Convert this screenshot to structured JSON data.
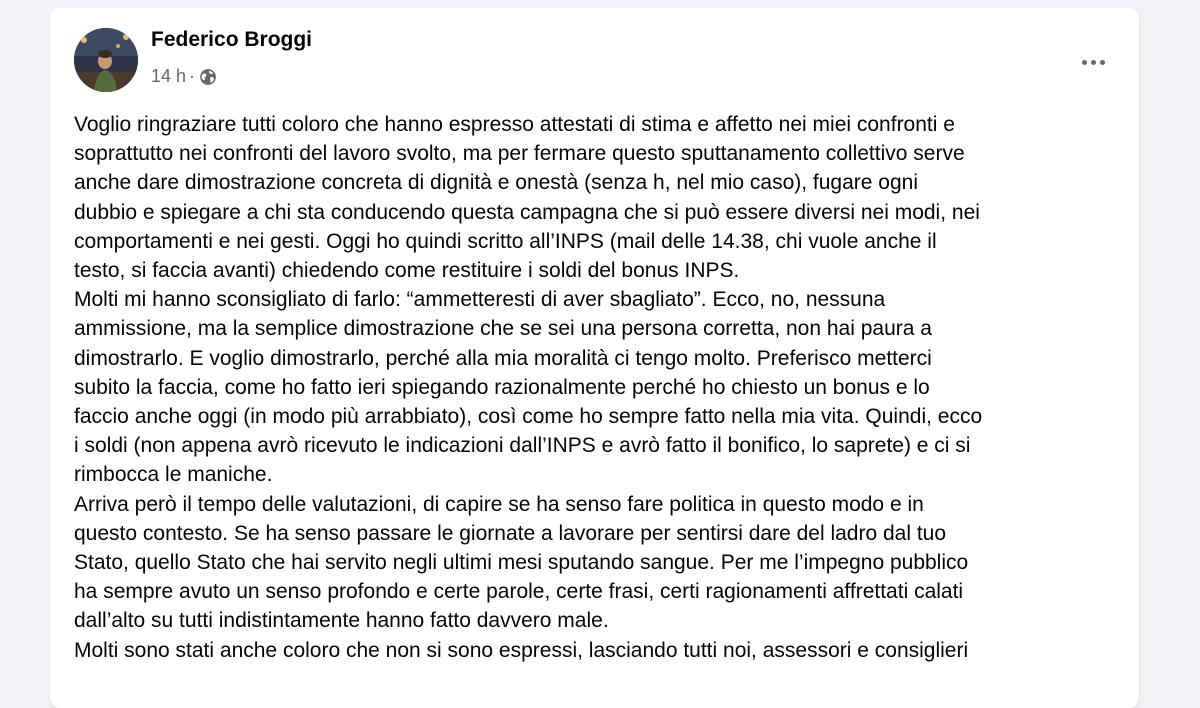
{
  "post": {
    "author": "Federico Broggi",
    "time": "14 h",
    "separator": "·",
    "privacy_icon": "globe-icon",
    "more_icon": "more-horizontal-icon",
    "paragraphs": [
      "Voglio ringraziare tutti coloro che hanno espresso attestati di stima e affetto nei miei confronti e\nsoprattutto nei confronti del lavoro svolto, ma per fermare questo sputtanamento collettivo serve\nanche dare dimostrazione concreta di dignità e onestà (senza h, nel mio caso), fugare ogni\ndubbio e spiegare a chi sta conducendo questa campagna che si può essere diversi nei modi, nei\ncomportamenti e nei gesti. Oggi ho quindi scritto all’INPS (mail delle 14.38, chi vuole anche il\ntesto, si faccia avanti) chiedendo come restituire i soldi del bonus INPS.",
      "Molti mi hanno sconsigliato di farlo: “ammetteresti di aver sbagliato”. Ecco, no, nessuna\nammissione, ma la semplice dimostrazione che se sei una persona corretta, non hai paura a\ndimostrarlo. E voglio dimostrarlo, perché alla mia moralità ci tengo molto. Preferisco metterci\nsubito la faccia, come ho fatto ieri spiegando razionalmente perché ho chiesto un bonus e lo\nfaccio anche oggi (in modo più arrabbiato), così come ho sempre fatto nella mia vita. Quindi, ecco\ni soldi (non appena avrò ricevuto le indicazioni dall’INPS e avrò fatto il bonifico, lo saprete) e ci si\nrimbocca le maniche.",
      "Arriva però il tempo delle valutazioni, di capire se ha senso fare politica in questo modo e in\nquesto contesto. Se ha senso passare le giornate a lavorare per sentirsi dare del ladro dal tuo\nStato, quello Stato che hai servito negli ultimi mesi sputando sangue. Per me l’impegno pubblico\nha sempre avuto un senso profondo e certe parole, certe frasi, certi ragionamenti affrettati calati\ndall’alto su tutti indistintamente hanno fatto davvero male.",
      "Molti sono stati anche coloro che non si sono espressi, lasciando tutti noi, assessori e consiglieri"
    ]
  }
}
